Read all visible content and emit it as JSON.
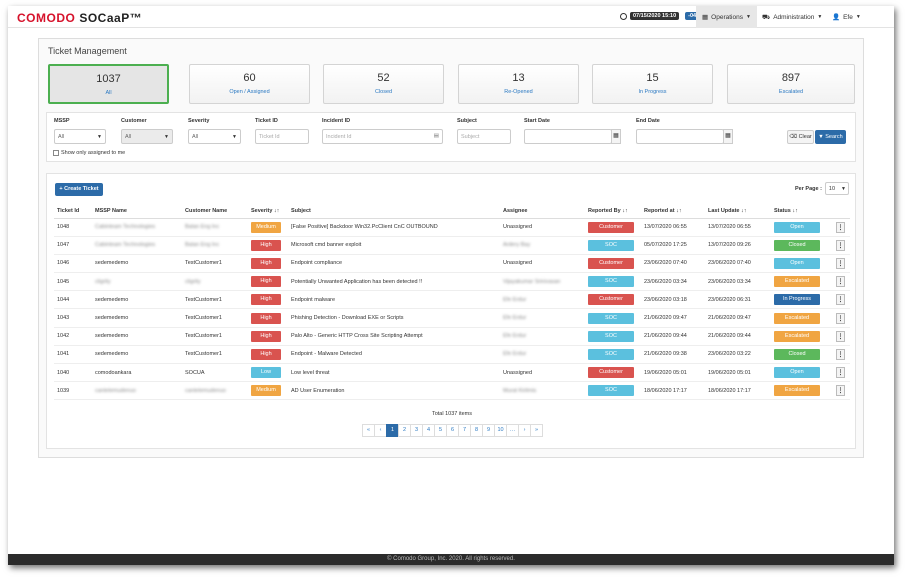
{
  "header": {
    "brand": "COMODO",
    "product": "SOCaaP™",
    "datetime": "07/15/2020 15:10",
    "tz": "-04",
    "nav_ops": "Operations",
    "nav_admin": "Administration",
    "nav_user": "Efe"
  },
  "page": {
    "title": "Ticket Management"
  },
  "cards": [
    {
      "num": "1037",
      "label": "All"
    },
    {
      "num": "60",
      "label": "Open / Assigned"
    },
    {
      "num": "52",
      "label": "Closed"
    },
    {
      "num": "13",
      "label": "Re-Opened"
    },
    {
      "num": "15",
      "label": "In Progress"
    },
    {
      "num": "897",
      "label": "Escalated"
    }
  ],
  "filters": {
    "mssp_label": "MSSP",
    "mssp_value": "All",
    "customer_label": "Customer",
    "customer_value": "All",
    "severity_label": "Severity",
    "severity_value": "All",
    "ticket_label": "Ticket ID",
    "ticket_ph": "Ticket Id",
    "incident_label": "Incident ID",
    "incident_ph": "Incident Id",
    "subject_label": "Subject",
    "subject_ph": "Subject",
    "start_label": "Start Date",
    "end_label": "End Date",
    "clear": "Clear",
    "search": "Search",
    "assigned_only": "Show only assigned to me"
  },
  "table": {
    "create": "Create Ticket",
    "per_page_label": "Per Page :",
    "per_page_value": "10",
    "headers": {
      "id": "Ticket Id",
      "mssp": "MSSP Name",
      "customer": "Customer Name",
      "severity": "Severity ↓↑",
      "subject": "Subject",
      "assignee": "Assignee",
      "reported_by": "Reported By ↓↑",
      "reported_at": "Reported at ↓↑",
      "last_update": "Last Update ↓↑",
      "status": "Status ↓↑"
    },
    "rows": [
      {
        "id": "1048",
        "mssp": "Cabinteam Technologies",
        "customer": "Balan Eng Inc",
        "severity": "Medium",
        "subject": "[False Positive] Backdoor Win32.PcClient CnC OUTBOUND",
        "assignee": "Unassigned",
        "reported_by": "Customer",
        "reported_at": "13/07/2020 06:55",
        "last_update": "13/07/2020 06:55",
        "status": "Open"
      },
      {
        "id": "1047",
        "mssp": "Cabinteam Technologies",
        "customer": "Balan Eng Inc",
        "severity": "High",
        "subject": "Microsoft cmd banner exploit",
        "assignee": "Ardery Bay",
        "reported_by": "SOC",
        "reported_at": "05/07/2020 17:25",
        "last_update": "13/07/2020 09:26",
        "status": "Closed"
      },
      {
        "id": "1046",
        "mssp": "sedemedemo",
        "customer": "TestCustomer1",
        "severity": "High",
        "subject": "Endpoint compliance",
        "assignee": "Unassigned",
        "reported_by": "Customer",
        "reported_at": "23/06/2020 07:40",
        "last_update": "23/06/2020 07:40",
        "status": "Open"
      },
      {
        "id": "1045",
        "mssp": "cligrity",
        "customer": "cligrity",
        "severity": "High",
        "subject": "Potentially Unwanted Application has been detected !!",
        "assignee": "Vijayakumar Srinivasan",
        "reported_by": "SOC",
        "reported_at": "23/06/2020 03:34",
        "last_update": "23/06/2020 03:34",
        "status": "Escalated"
      },
      {
        "id": "1044",
        "mssp": "sedemedemo",
        "customer": "TestCustomer1",
        "severity": "High",
        "subject": "Endpoint malware",
        "assignee": "Efe Erdur",
        "reported_by": "Customer",
        "reported_at": "23/06/2020 03:18",
        "last_update": "23/06/2020 06:31",
        "status": "In Progress"
      },
      {
        "id": "1043",
        "mssp": "sedemedemo",
        "customer": "TestCustomer1",
        "severity": "High",
        "subject": "Phishing Detection - Download EXE or Scripts",
        "assignee": "Efe Erdur",
        "reported_by": "SOC",
        "reported_at": "21/06/2020 09:47",
        "last_update": "21/06/2020 09:47",
        "status": "Escalated"
      },
      {
        "id": "1042",
        "mssp": "sedemedemo",
        "customer": "TestCustomer1",
        "severity": "High",
        "subject": "Palo Alto - Generic HTTP Cross Site Scripting Attempt",
        "assignee": "Efe Erdur",
        "reported_by": "SOC",
        "reported_at": "21/06/2020 09:44",
        "last_update": "21/06/2020 09:44",
        "status": "Escalated"
      },
      {
        "id": "1041",
        "mssp": "sedemedemo",
        "customer": "TestCustomer1",
        "severity": "High",
        "subject": "Endpoint - Malware Detected",
        "assignee": "Efe Erdur",
        "reported_by": "SOC",
        "reported_at": "21/06/2020 09:38",
        "last_update": "23/06/2020 03:22",
        "status": "Closed"
      },
      {
        "id": "1040",
        "mssp": "comodoankara",
        "customer": "SOCUA",
        "severity": "Low",
        "subject": "Low level threat",
        "assignee": "Unassigned",
        "reported_by": "Customer",
        "reported_at": "19/06/2020 05:01",
        "last_update": "19/06/2020 05:01",
        "status": "Open"
      },
      {
        "id": "1039",
        "mssp": "cantetemudenuo",
        "customer": "cantetemudenuo",
        "severity": "Medium",
        "subject": "AD User Enumeration",
        "assignee": "Murat Kirilmis",
        "reported_by": "SOC",
        "reported_at": "18/06/2020 17:17",
        "last_update": "18/06/2020 17:17",
        "status": "Escalated"
      }
    ],
    "total": "Total 1037 items",
    "pages": [
      "«",
      "‹",
      "1",
      "2",
      "3",
      "4",
      "5",
      "6",
      "7",
      "8",
      "9",
      "10",
      "…",
      "›",
      "»"
    ]
  },
  "footer": "© Comodo Group, Inc. 2020. All rights reserved.",
  "colors": {
    "Medium": "#f0a542",
    "High": "#d9534f",
    "Low": "#5bc0de",
    "Customer": "#d9534f",
    "SOC": "#5bc0de",
    "Open": "#5bc0de",
    "Closed": "#5cb85c",
    "Escalated": "#f0a542",
    "In Progress": "#2c6ba8"
  }
}
